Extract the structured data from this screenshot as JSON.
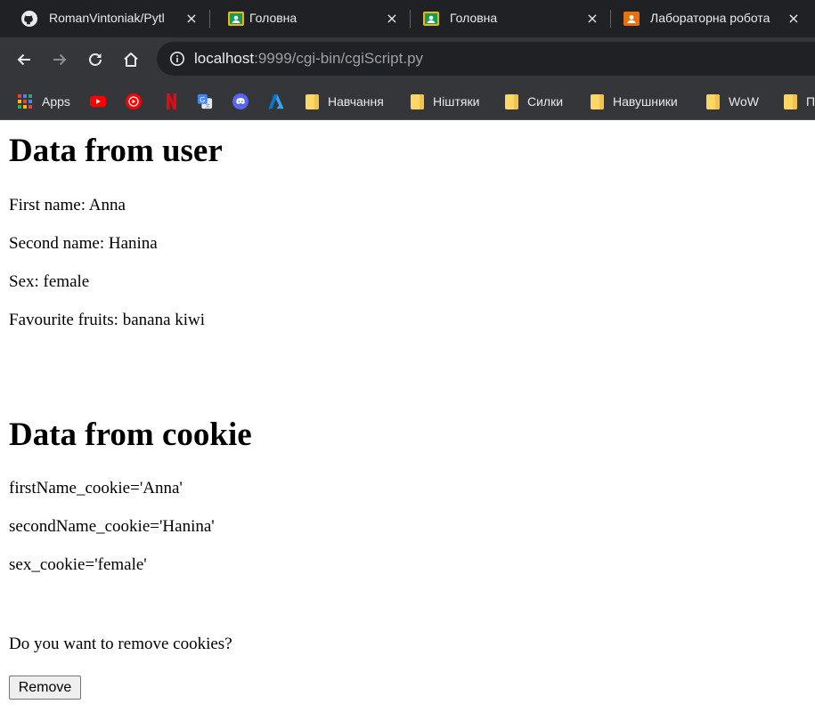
{
  "browser": {
    "tabs": [
      {
        "title": "RomanVintoniak/Pytl",
        "favicon": "github-icon"
      },
      {
        "title": "Головна",
        "favicon": "google-classroom-icon"
      },
      {
        "title": "Головна",
        "favicon": "google-classroom-icon"
      },
      {
        "title": "Лабораторна робота",
        "favicon": "google-classroom-orange-icon"
      }
    ],
    "close_glyph": "×",
    "url_host": "localhost",
    "url_rest": ":9999/cgi-bin/cgiScript.py",
    "bookmarks": {
      "apps": "Apps",
      "folders": [
        "Навчання",
        "Ніштяки",
        "Силки",
        "Навушники",
        "WoW",
        "П"
      ]
    }
  },
  "page": {
    "user_heading": "Data from user",
    "first_name": "First name: Anna",
    "second_name": "Second name: Hanina",
    "sex": "Sex: female",
    "fruits": "Favourite fruits: banana kiwi",
    "cookie_heading": "Data from cookie",
    "cookie_first": "firstName_cookie='Anna'",
    "cookie_second": "secondName_cookie='Hanina'",
    "cookie_sex": "sex_cookie='female'",
    "remove_question": "Do you want to remove cookies?",
    "remove_button": "Remove"
  }
}
